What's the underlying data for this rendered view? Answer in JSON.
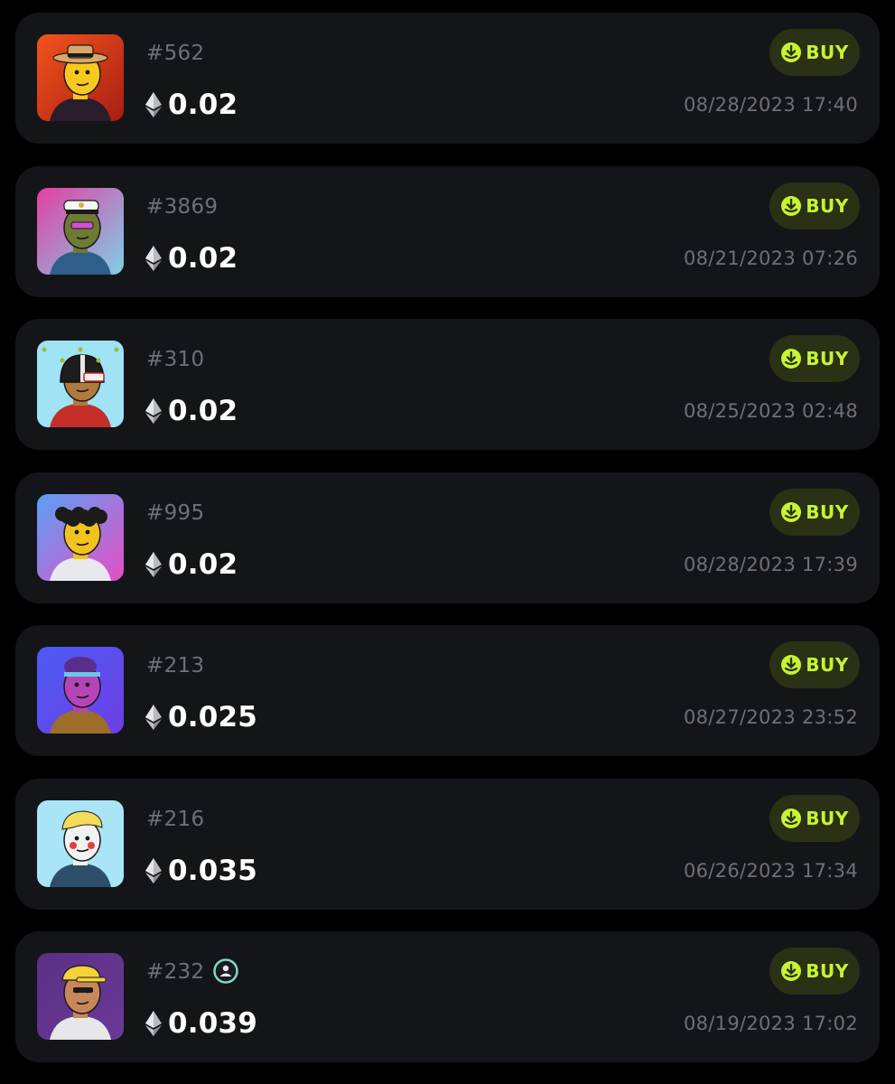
{
  "colors": {
    "background": "#000000",
    "card": "#141519",
    "muted_text": "#6f7077",
    "price_text": "#ffffff",
    "buy_accent": "#c6f432",
    "buy_bg": "#2b3114"
  },
  "listings": [
    {
      "id": "#562",
      "price": "0.02",
      "buy_label": "BUY",
      "timestamp": "08/28/2023 17:40",
      "icons": {
        "currency": "ethereum-icon",
        "buy": "buy-arrow-icon"
      },
      "avatar": {
        "bg": [
          "#f2541b",
          "#a81d14"
        ],
        "skin": "#f7c81e",
        "hat": "#d9a66b",
        "shirt": "#2b1e2c",
        "accessory": "hat"
      }
    },
    {
      "id": "#3869",
      "price": "0.02",
      "buy_label": "BUY",
      "timestamp": "08/21/2023 07:26",
      "icons": {
        "currency": "ethereum-icon",
        "buy": "buy-arrow-icon"
      },
      "avatar": {
        "bg": [
          "#e23fa2",
          "#7fd0e8"
        ],
        "skin": "#6f7a35",
        "hat": "#f4f4f4",
        "shirt": "#2d5f8a",
        "accessory": "captain-hat"
      }
    },
    {
      "id": "#310",
      "price": "0.02",
      "buy_label": "BUY",
      "timestamp": "08/25/2023 02:48",
      "icons": {
        "currency": "ethereum-icon",
        "buy": "buy-arrow-icon"
      },
      "avatar": {
        "bg": [
          "#9fe3f5",
          "#9fe3f5"
        ],
        "skin": "#b07a3c",
        "hat": "#1d1d1d",
        "shirt": "#c42f2a",
        "accessory": "helmet"
      }
    },
    {
      "id": "#995",
      "price": "0.02",
      "buy_label": "BUY",
      "timestamp": "08/28/2023 17:39",
      "icons": {
        "currency": "ethereum-icon",
        "buy": "buy-arrow-icon"
      },
      "avatar": {
        "bg": [
          "#5aa0f5",
          "#e64fc4"
        ],
        "skin": "#f2c21e",
        "hat": "#1b1b1b",
        "shirt": "#e8e8ee",
        "accessory": "curly-hair"
      }
    },
    {
      "id": "#213",
      "price": "0.025",
      "buy_label": "BUY",
      "timestamp": "08/27/2023 23:52",
      "icons": {
        "currency": "ethereum-icon",
        "buy": "buy-arrow-icon"
      },
      "avatar": {
        "bg": [
          "#4c5bf0",
          "#6e3ee8"
        ],
        "skin": "#b544b8",
        "hat": "#5a2d8a",
        "shirt": "#9c6d2b",
        "accessory": "headband"
      }
    },
    {
      "id": "#216",
      "price": "0.035",
      "buy_label": "BUY",
      "timestamp": "06/26/2023 17:34",
      "icons": {
        "currency": "ethereum-icon",
        "buy": "buy-arrow-icon"
      },
      "avatar": {
        "bg": [
          "#a9e4f7",
          "#a9e4f7"
        ],
        "skin": "#f2f2f2",
        "hat": "#f3dc58",
        "shirt": "#2e4f6b",
        "accessory": "blonde-hair"
      }
    },
    {
      "id": "#232",
      "price": "0.039",
      "buy_label": "BUY",
      "timestamp": "08/19/2023 17:02",
      "badge": "verified-user-icon",
      "icons": {
        "currency": "ethereum-icon",
        "buy": "buy-arrow-icon"
      },
      "avatar": {
        "bg": [
          "#5b2f86",
          "#6a3a96"
        ],
        "skin": "#c8875b",
        "hat": "#f3d23a",
        "shirt": "#e7e7ea",
        "accessory": "cap"
      }
    }
  ]
}
